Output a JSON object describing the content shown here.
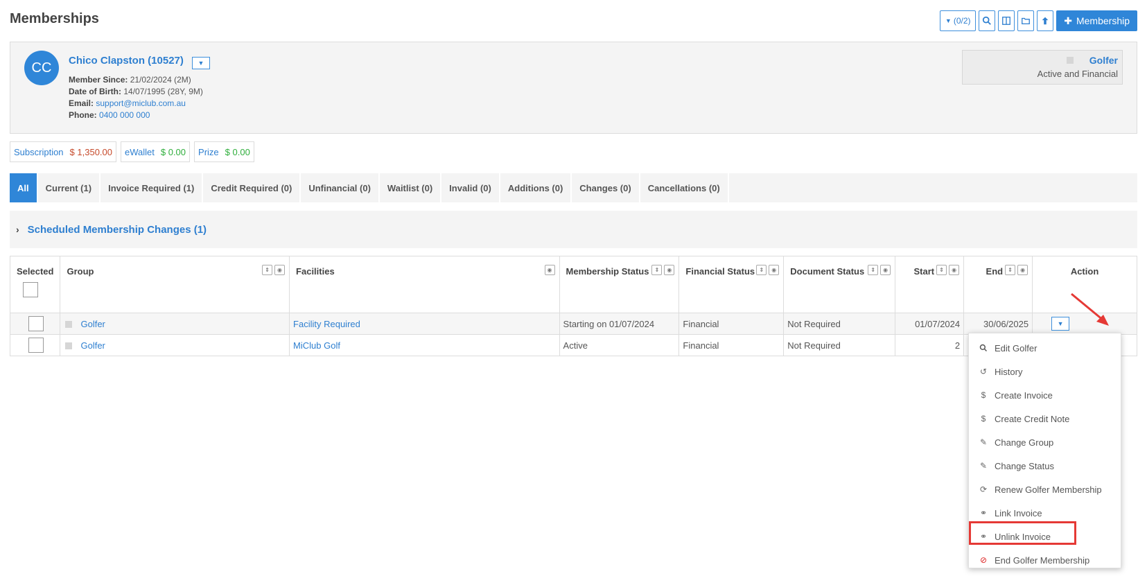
{
  "page": {
    "title": "Memberships"
  },
  "toolbar": {
    "filter_label": "(0/2)",
    "add_membership_label": "Membership"
  },
  "member": {
    "initials": "CC",
    "name": "Chico Clapston (10527)",
    "member_since_label": "Member Since:",
    "member_since": "21/02/2024 (2M)",
    "dob_label": "Date of Birth:",
    "dob": "14/07/1995 (28Y, 9M)",
    "email_label": "Email:",
    "email": "support@miclub.com.au",
    "phone_label": "Phone:",
    "phone": "0400 000 000",
    "status_group": "Golfer",
    "status_text": "Active and Financial"
  },
  "balances": [
    {
      "label": "Subscription",
      "amount": "$ 1,350.00"
    },
    {
      "label": "eWallet",
      "amount": "$ 0.00"
    },
    {
      "label": "Prize",
      "amount": "$ 0.00"
    }
  ],
  "tabs": [
    {
      "label": "All"
    },
    {
      "label": "Current (1)"
    },
    {
      "label": "Invoice Required (1)"
    },
    {
      "label": "Credit Required (0)"
    },
    {
      "label": "Unfinancial (0)"
    },
    {
      "label": "Waitlist (0)"
    },
    {
      "label": "Invalid (0)"
    },
    {
      "label": "Additions (0)"
    },
    {
      "label": "Changes (0)"
    },
    {
      "label": "Cancellations (0)"
    }
  ],
  "scheduled": {
    "label": "Scheduled Membership Changes (1)"
  },
  "table": {
    "headers": [
      "Selected",
      "Group",
      "Facilities",
      "Membership Status",
      "Financial Status",
      "Document Status",
      "Start",
      "End",
      "Action"
    ],
    "rows": [
      {
        "group": "Golfer",
        "facility": "Facility Required",
        "membership_status": "Starting on 01/07/2024",
        "financial_status": "Financial",
        "document_status": "Not Required",
        "start": "01/07/2024",
        "end": "30/06/2025"
      },
      {
        "group": "Golfer",
        "facility": "MiClub Golf",
        "membership_status": "Active",
        "financial_status": "Financial",
        "document_status": "Not Required",
        "start": "2",
        "end": ""
      }
    ]
  },
  "action_menu": [
    {
      "label": "Edit Golfer",
      "icon": "search-icon"
    },
    {
      "label": "History",
      "icon": "history-icon"
    },
    {
      "label": "Create Invoice",
      "icon": "dollar-icon"
    },
    {
      "label": "Create Credit Note",
      "icon": "dollar-icon"
    },
    {
      "label": "Change Group",
      "icon": "pencil-icon"
    },
    {
      "label": "Change Status",
      "icon": "pencil-icon"
    },
    {
      "label": "Renew Golfer Membership",
      "icon": "refresh-icon"
    },
    {
      "label": "Link Invoice",
      "icon": "link-icon"
    },
    {
      "label": "Unlink Invoice",
      "icon": "unlink-icon"
    },
    {
      "label": "End Golfer Membership",
      "icon": "ban-icon"
    }
  ],
  "colors": {
    "accent": "#2f86d8",
    "highlight": "#e53935",
    "amount_red": "#c64a2b",
    "amount_green": "#2fae3c"
  }
}
